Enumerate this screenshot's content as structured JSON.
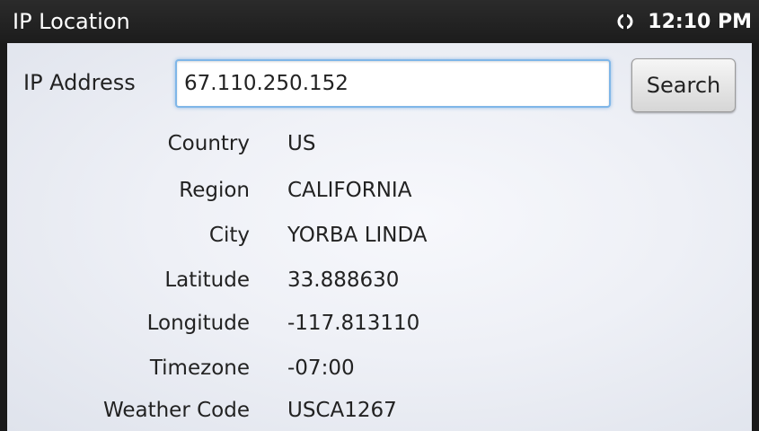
{
  "titlebar": {
    "title": "IP Location",
    "clock": "12:10 PM",
    "icons": [
      "sync-icon"
    ]
  },
  "form": {
    "ip_label": "IP Address",
    "ip_value": "67.110.250.152",
    "search_label": "Search"
  },
  "results": [
    {
      "label": "Country",
      "value": "US"
    },
    {
      "label": "Region",
      "value": "CALIFORNIA"
    },
    {
      "label": "City",
      "value": "YORBA LINDA"
    },
    {
      "label": "Latitude",
      "value": "33.888630"
    },
    {
      "label": "Longitude",
      "value": "-117.813110"
    },
    {
      "label": "Timezone",
      "value": "-07:00"
    },
    {
      "label": "Weather Code",
      "value": "USCA1267"
    }
  ],
  "colors": {
    "titlebar_bg": "#1c1c1c",
    "input_focus": "#7fb6e8",
    "content_bg": "#eef0f6"
  }
}
